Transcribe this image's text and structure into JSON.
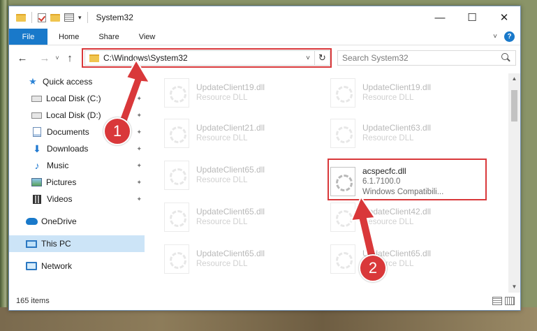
{
  "window": {
    "title": "System32",
    "controls": {
      "minimize": "—",
      "maximize": "☐",
      "close": "✕"
    }
  },
  "ribbon": {
    "tabs": [
      "File",
      "Home",
      "Share",
      "View"
    ],
    "expand_icon": "chevron-down-icon",
    "help_label": "?"
  },
  "nav": {
    "back": "←",
    "forward": "→",
    "recent": "˅",
    "up": "↑",
    "address": "C:\\Windows\\System32",
    "refresh": "↻",
    "search_placeholder": "Search System32"
  },
  "sidebar": {
    "items": [
      {
        "label": "Quick access",
        "icon": "star-icon",
        "pinned": false
      },
      {
        "label": "Local Disk (C:)",
        "icon": "disk-icon",
        "pinned": true
      },
      {
        "label": "Local Disk (D:)",
        "icon": "disk-icon",
        "pinned": true
      },
      {
        "label": "Documents",
        "icon": "documents-icon",
        "pinned": true
      },
      {
        "label": "Downloads",
        "icon": "download-icon",
        "pinned": true
      },
      {
        "label": "Music",
        "icon": "music-icon",
        "pinned": true
      },
      {
        "label": "Pictures",
        "icon": "pictures-icon",
        "pinned": true
      },
      {
        "label": "Videos",
        "icon": "videos-icon",
        "pinned": true
      },
      {
        "label": "OneDrive",
        "icon": "cloud-icon",
        "pinned": false
      },
      {
        "label": "This PC",
        "icon": "pc-icon",
        "pinned": false,
        "selected": true
      },
      {
        "label": "Network",
        "icon": "network-icon",
        "pinned": false
      }
    ],
    "pin_glyph": "📌"
  },
  "files": {
    "left": [
      {
        "name": "UpdateClient19.dll",
        "type": "Resource DLL"
      },
      {
        "name": "UpdateClient21.dll",
        "type": "Resource DLL"
      },
      {
        "name": "UpdateClient65.dll",
        "type": "Resource DLL"
      },
      {
        "name": "UpdateClient65.dll",
        "type": "Resource DLL"
      },
      {
        "name": "UpdateClient65.dll",
        "type": "Resource DLL"
      }
    ],
    "right": [
      {
        "name": "UpdateClient19.dll",
        "type": "Resource DLL"
      },
      {
        "name": "UpdateClient63.dll",
        "type": "Resource DLL"
      },
      {
        "name": "acspecfc.dll",
        "version": "6.1.7100.0",
        "type": "Windows Compatibili..."
      },
      {
        "name": "UpdateClient42.dll",
        "type": "Resource DLL"
      },
      {
        "name": "UpdateClient65.dll",
        "type": "Resource DLL"
      }
    ]
  },
  "status": {
    "count": "165 items"
  },
  "annotations": {
    "step1": "1",
    "step2": "2",
    "color": "#d9383a"
  }
}
